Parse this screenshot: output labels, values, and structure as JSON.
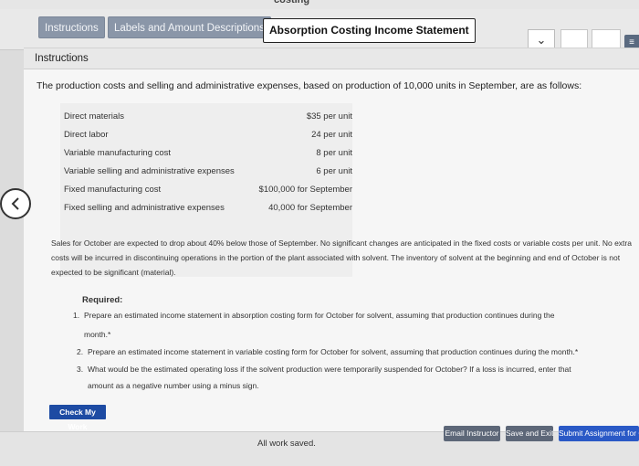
{
  "top_cut_text": "costing",
  "tabs": [
    {
      "label": "Instructions",
      "active": false
    },
    {
      "label": "Labels and Amount Descriptions",
      "active": false
    },
    {
      "label": "Absorption Costing Income Statement",
      "active": true
    }
  ],
  "dropdown_glyph": "⌄",
  "right_pill_glyph": "≡",
  "instructions": {
    "title": "Instructions",
    "intro": "The production costs and selling and administrative expenses, based on production of 10,000 units in September, are as follows:",
    "costs": [
      {
        "label": "Direct materials",
        "value": "$35 per unit"
      },
      {
        "label": "Direct labor",
        "value": "24 per unit"
      },
      {
        "label": "Variable manufacturing cost",
        "value": "8 per unit"
      },
      {
        "label": "Variable selling and administrative expenses",
        "value": "6 per unit"
      },
      {
        "label": "Fixed manufacturing cost",
        "value": "$100,000 for September"
      },
      {
        "label": "Fixed selling and administrative expenses",
        "value": "40,000 for September"
      }
    ],
    "paragraph": "Sales for October are expected to drop about 40% below those of September. No significant changes are anticipated in the fixed costs or variable costs per unit. No extra costs will be incurred in discontinuing operations in the portion of the plant associated with solvent. The inventory of solvent at the beginning and end of October is not expected to be significant (material).",
    "required_title": "Required:",
    "required": [
      {
        "num": "1.",
        "line1": "Prepare an estimated income statement in absorption costing form for October for solvent, assuming that production continues during the",
        "line2": "month.*"
      },
      {
        "num": "2.",
        "line1": "Prepare an estimated income statement in variable costing form for October for solvent, assuming that production continues during the month.*",
        "line2": ""
      },
      {
        "num": "3.",
        "line1": "What would be the estimated operating loss if the solvent production were temporarily suspended for October? If a loss is incurred, enter that",
        "line2": "amount as a negative number using a minus sign."
      }
    ]
  },
  "check_button": "Check My Work",
  "footer": {
    "status": "All work saved.",
    "email_label": "Email Instructor",
    "save_exit_label": "Save and Exit",
    "submit_label": "Submit Assignment for Grading"
  }
}
